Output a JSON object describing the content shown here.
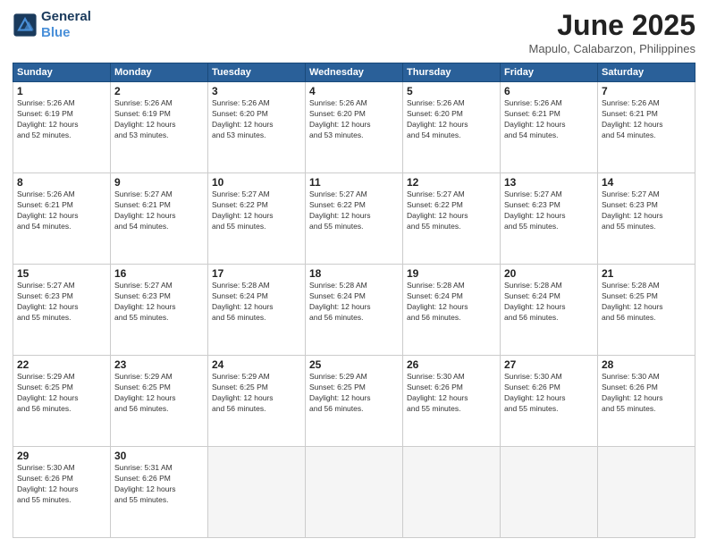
{
  "header": {
    "logo_line1": "General",
    "logo_line2": "Blue",
    "month_title": "June 2025",
    "location": "Mapulo, Calabarzon, Philippines"
  },
  "weekdays": [
    "Sunday",
    "Monday",
    "Tuesday",
    "Wednesday",
    "Thursday",
    "Friday",
    "Saturday"
  ],
  "weeks": [
    [
      {
        "day": "1",
        "lines": [
          "Sunrise: 5:26 AM",
          "Sunset: 6:19 PM",
          "Daylight: 12 hours",
          "and 52 minutes."
        ]
      },
      {
        "day": "2",
        "lines": [
          "Sunrise: 5:26 AM",
          "Sunset: 6:19 PM",
          "Daylight: 12 hours",
          "and 53 minutes."
        ]
      },
      {
        "day": "3",
        "lines": [
          "Sunrise: 5:26 AM",
          "Sunset: 6:20 PM",
          "Daylight: 12 hours",
          "and 53 minutes."
        ]
      },
      {
        "day": "4",
        "lines": [
          "Sunrise: 5:26 AM",
          "Sunset: 6:20 PM",
          "Daylight: 12 hours",
          "and 53 minutes."
        ]
      },
      {
        "day": "5",
        "lines": [
          "Sunrise: 5:26 AM",
          "Sunset: 6:20 PM",
          "Daylight: 12 hours",
          "and 54 minutes."
        ]
      },
      {
        "day": "6",
        "lines": [
          "Sunrise: 5:26 AM",
          "Sunset: 6:21 PM",
          "Daylight: 12 hours",
          "and 54 minutes."
        ]
      },
      {
        "day": "7",
        "lines": [
          "Sunrise: 5:26 AM",
          "Sunset: 6:21 PM",
          "Daylight: 12 hours",
          "and 54 minutes."
        ]
      }
    ],
    [
      {
        "day": "8",
        "lines": [
          "Sunrise: 5:26 AM",
          "Sunset: 6:21 PM",
          "Daylight: 12 hours",
          "and 54 minutes."
        ]
      },
      {
        "day": "9",
        "lines": [
          "Sunrise: 5:27 AM",
          "Sunset: 6:21 PM",
          "Daylight: 12 hours",
          "and 54 minutes."
        ]
      },
      {
        "day": "10",
        "lines": [
          "Sunrise: 5:27 AM",
          "Sunset: 6:22 PM",
          "Daylight: 12 hours",
          "and 55 minutes."
        ]
      },
      {
        "day": "11",
        "lines": [
          "Sunrise: 5:27 AM",
          "Sunset: 6:22 PM",
          "Daylight: 12 hours",
          "and 55 minutes."
        ]
      },
      {
        "day": "12",
        "lines": [
          "Sunrise: 5:27 AM",
          "Sunset: 6:22 PM",
          "Daylight: 12 hours",
          "and 55 minutes."
        ]
      },
      {
        "day": "13",
        "lines": [
          "Sunrise: 5:27 AM",
          "Sunset: 6:23 PM",
          "Daylight: 12 hours",
          "and 55 minutes."
        ]
      },
      {
        "day": "14",
        "lines": [
          "Sunrise: 5:27 AM",
          "Sunset: 6:23 PM",
          "Daylight: 12 hours",
          "and 55 minutes."
        ]
      }
    ],
    [
      {
        "day": "15",
        "lines": [
          "Sunrise: 5:27 AM",
          "Sunset: 6:23 PM",
          "Daylight: 12 hours",
          "and 55 minutes."
        ]
      },
      {
        "day": "16",
        "lines": [
          "Sunrise: 5:27 AM",
          "Sunset: 6:23 PM",
          "Daylight: 12 hours",
          "and 55 minutes."
        ]
      },
      {
        "day": "17",
        "lines": [
          "Sunrise: 5:28 AM",
          "Sunset: 6:24 PM",
          "Daylight: 12 hours",
          "and 56 minutes."
        ]
      },
      {
        "day": "18",
        "lines": [
          "Sunrise: 5:28 AM",
          "Sunset: 6:24 PM",
          "Daylight: 12 hours",
          "and 56 minutes."
        ]
      },
      {
        "day": "19",
        "lines": [
          "Sunrise: 5:28 AM",
          "Sunset: 6:24 PM",
          "Daylight: 12 hours",
          "and 56 minutes."
        ]
      },
      {
        "day": "20",
        "lines": [
          "Sunrise: 5:28 AM",
          "Sunset: 6:24 PM",
          "Daylight: 12 hours",
          "and 56 minutes."
        ]
      },
      {
        "day": "21",
        "lines": [
          "Sunrise: 5:28 AM",
          "Sunset: 6:25 PM",
          "Daylight: 12 hours",
          "and 56 minutes."
        ]
      }
    ],
    [
      {
        "day": "22",
        "lines": [
          "Sunrise: 5:29 AM",
          "Sunset: 6:25 PM",
          "Daylight: 12 hours",
          "and 56 minutes."
        ]
      },
      {
        "day": "23",
        "lines": [
          "Sunrise: 5:29 AM",
          "Sunset: 6:25 PM",
          "Daylight: 12 hours",
          "and 56 minutes."
        ]
      },
      {
        "day": "24",
        "lines": [
          "Sunrise: 5:29 AM",
          "Sunset: 6:25 PM",
          "Daylight: 12 hours",
          "and 56 minutes."
        ]
      },
      {
        "day": "25",
        "lines": [
          "Sunrise: 5:29 AM",
          "Sunset: 6:25 PM",
          "Daylight: 12 hours",
          "and 56 minutes."
        ]
      },
      {
        "day": "26",
        "lines": [
          "Sunrise: 5:30 AM",
          "Sunset: 6:26 PM",
          "Daylight: 12 hours",
          "and 55 minutes."
        ]
      },
      {
        "day": "27",
        "lines": [
          "Sunrise: 5:30 AM",
          "Sunset: 6:26 PM",
          "Daylight: 12 hours",
          "and 55 minutes."
        ]
      },
      {
        "day": "28",
        "lines": [
          "Sunrise: 5:30 AM",
          "Sunset: 6:26 PM",
          "Daylight: 12 hours",
          "and 55 minutes."
        ]
      }
    ],
    [
      {
        "day": "29",
        "lines": [
          "Sunrise: 5:30 AM",
          "Sunset: 6:26 PM",
          "Daylight: 12 hours",
          "and 55 minutes."
        ]
      },
      {
        "day": "30",
        "lines": [
          "Sunrise: 5:31 AM",
          "Sunset: 6:26 PM",
          "Daylight: 12 hours",
          "and 55 minutes."
        ]
      },
      {
        "day": "",
        "lines": []
      },
      {
        "day": "",
        "lines": []
      },
      {
        "day": "",
        "lines": []
      },
      {
        "day": "",
        "lines": []
      },
      {
        "day": "",
        "lines": []
      }
    ]
  ]
}
